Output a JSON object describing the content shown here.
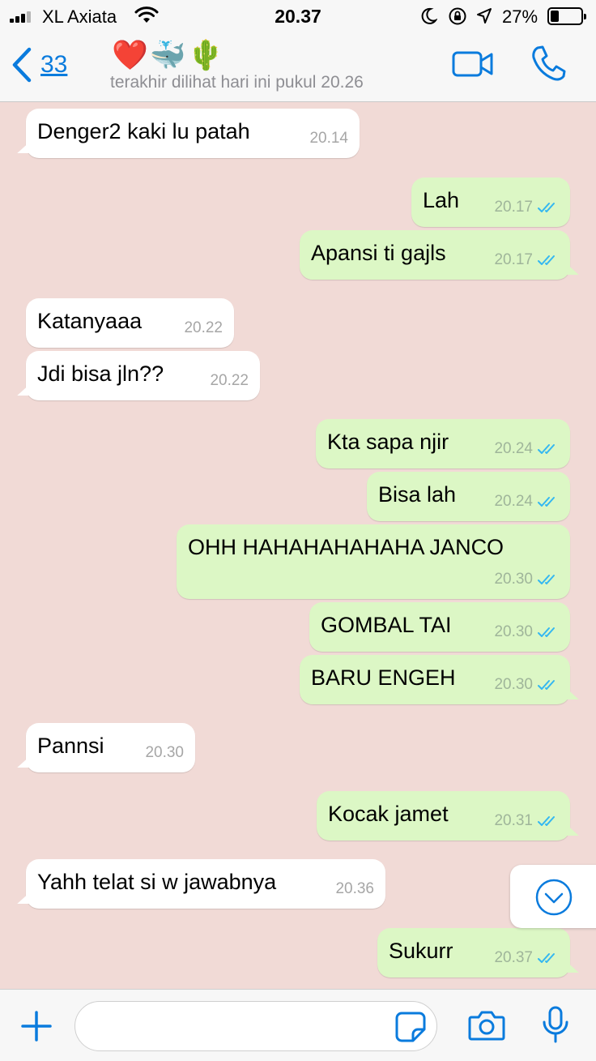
{
  "status_bar": {
    "carrier": "XL Axiata",
    "time": "20.37",
    "battery_percent": "27%",
    "battery_level": 0.27
  },
  "header": {
    "back_count": "33",
    "contact_name": "❤️🐳🌵",
    "last_seen": "terakhir dilihat hari ini pukul 20.26"
  },
  "messages": [
    {
      "direction": "in",
      "text": "Denger2 kaki lu patah",
      "time": "20.14"
    },
    {
      "direction": "out",
      "text": "Lah",
      "time": "20.17",
      "status": "read"
    },
    {
      "direction": "out",
      "text": "Apansi ti gajls",
      "time": "20.17",
      "status": "read"
    },
    {
      "direction": "in",
      "text": "Katanyaaa",
      "time": "20.22"
    },
    {
      "direction": "in",
      "text": "Jdi bisa jln??",
      "time": "20.22"
    },
    {
      "direction": "out",
      "text": "Kta sapa njir",
      "time": "20.24",
      "status": "read"
    },
    {
      "direction": "out",
      "text": "Bisa lah",
      "time": "20.24",
      "status": "read"
    },
    {
      "direction": "out",
      "text": "OHH HAHAHAHAHAHA JANCO",
      "time": "20.30",
      "status": "read"
    },
    {
      "direction": "out",
      "text": "GOMBAL TAI",
      "time": "20.30",
      "status": "read"
    },
    {
      "direction": "out",
      "text": "BARU ENGEH",
      "time": "20.30",
      "status": "read"
    },
    {
      "direction": "in",
      "text": "Pannsi",
      "time": "20.30"
    },
    {
      "direction": "out",
      "text": "Kocak jamet",
      "time": "20.31",
      "status": "read"
    },
    {
      "direction": "in",
      "text": "Yahh telat si w jawabnya",
      "time": "20.36"
    },
    {
      "direction": "out",
      "text": "Sukurr",
      "time": "20.37",
      "status": "read"
    }
  ],
  "input": {
    "value": "",
    "placeholder": ""
  },
  "colors": {
    "accent": "#0a7bdd",
    "chat_background": "#f1dad6",
    "outgoing_bubble": "#dcf7c5",
    "incoming_bubble": "#ffffff",
    "read_ticks": "#34b7f1"
  }
}
